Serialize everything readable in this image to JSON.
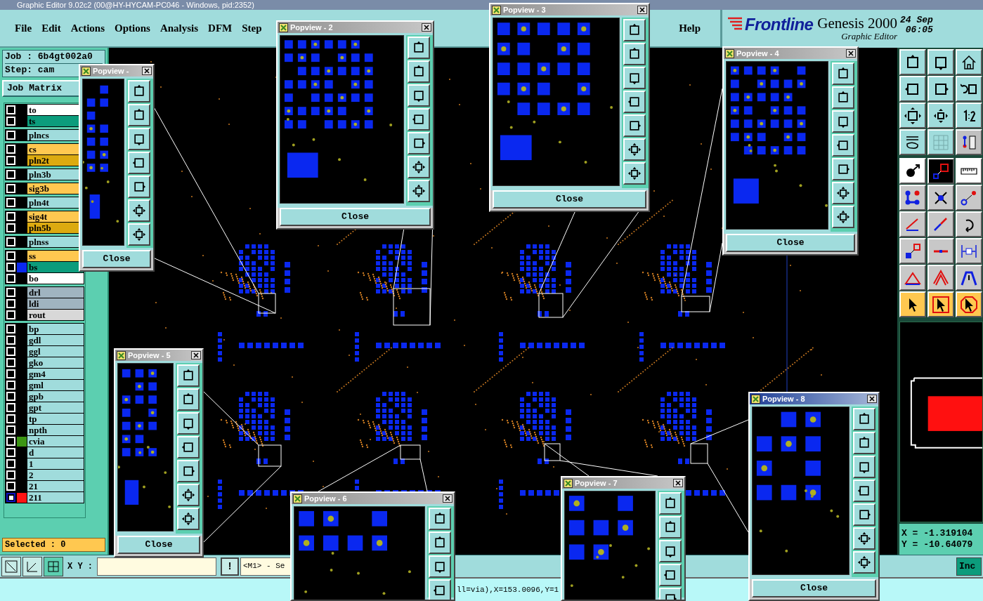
{
  "window": {
    "title": "Graphic Editor 9.02c2 (00@HY-HYCAM-PC046 - Windows, pid:2352)"
  },
  "menu": [
    {
      "label": "File"
    },
    {
      "label": "Edit"
    },
    {
      "label": "Actions"
    },
    {
      "label": "Options"
    },
    {
      "label": "Analysis"
    },
    {
      "label": "DFM"
    },
    {
      "label": "Step"
    }
  ],
  "help_menu": {
    "label": "Help"
  },
  "logo": {
    "brand": "Frontline",
    "product": "Genesis 2000",
    "subtitle": "Graphic Editor",
    "date": "24 Sep",
    "time": "06:05"
  },
  "job": {
    "job": "Job : 6b4gt002a0",
    "step": "Step: cam",
    "matrix_button": "Job Matrix"
  },
  "layer_groups": [
    [
      {
        "name": "to",
        "color": "#ffffff",
        "selected": false
      },
      {
        "name": "ts",
        "color": "#0c9c7c",
        "selected": false
      }
    ],
    [
      {
        "name": "plncs",
        "color": "#a0dcdc",
        "selected": false
      }
    ],
    [
      {
        "name": "cs",
        "color": "#ffc850",
        "selected": false
      },
      {
        "name": "pln2t",
        "color": "#dcaa10",
        "selected": false
      }
    ],
    [
      {
        "name": "pln3b",
        "color": "#a0dcdc",
        "selected": false
      }
    ],
    [
      {
        "name": "sig3b",
        "color": "#ffc850",
        "selected": false
      }
    ],
    [
      {
        "name": "pln4t",
        "color": "#a0dcdc",
        "selected": false
      }
    ],
    [
      {
        "name": "sig4t",
        "color": "#ffc850",
        "selected": false
      },
      {
        "name": "pln5b",
        "color": "#dcaa10",
        "selected": false
      }
    ],
    [
      {
        "name": "plnss",
        "color": "#a0dcdc",
        "selected": false
      }
    ],
    [
      {
        "name": "ss",
        "color": "#ffc850",
        "selected": false
      },
      {
        "name": "bs",
        "color": "#0c9c7c",
        "swatch": {
          "color": "#0a28f0"
        },
        "selected": false
      },
      {
        "name": "bo",
        "color": "#ffffff",
        "selected": false
      }
    ],
    [
      {
        "name": "drl",
        "color": "#a0b4c0",
        "selected": false
      },
      {
        "name": "ldi",
        "color": "#a0b4c0",
        "selected": false
      },
      {
        "name": "rout",
        "color": "#d8d8d8",
        "selected": false
      }
    ],
    [
      {
        "name": "bp",
        "color": "#a0dcdc",
        "selected": false
      },
      {
        "name": "gdl",
        "color": "#a0dcdc",
        "selected": false
      },
      {
        "name": "ggl",
        "color": "#a0dcdc",
        "selected": false
      },
      {
        "name": "gko",
        "color": "#a0dcdc",
        "selected": false
      },
      {
        "name": "gm4",
        "color": "#a0dcdc",
        "selected": false
      },
      {
        "name": "gml",
        "color": "#a0dcdc",
        "selected": false
      },
      {
        "name": "gpb",
        "color": "#a0dcdc",
        "selected": false
      },
      {
        "name": "gpt",
        "color": "#a0dcdc",
        "selected": false
      },
      {
        "name": "tp",
        "color": "#a0dcdc",
        "selected": false
      },
      {
        "name": "npth",
        "color": "#a0dcdc",
        "selected": false
      },
      {
        "name": "cvia",
        "color": "#a0dcdc",
        "swatch": {
          "color": "#3c9614"
        },
        "selected": false
      },
      {
        "name": "d",
        "color": "#a0dcdc",
        "selected": false
      },
      {
        "name": "1",
        "color": "#a0dcdc",
        "selected": false
      },
      {
        "name": "2",
        "color": "#a0dcdc",
        "selected": false
      },
      {
        "name": "21",
        "color": "#a0dcdc",
        "selected": false
      },
      {
        "name": "211",
        "color": "#a0dcdc",
        "swatch": {
          "color": "#ff1414"
        },
        "selected": true
      }
    ]
  ],
  "selected_count": "Selected : 0",
  "popviews": [
    {
      "title": "Popview -",
      "active": false,
      "close_label": "Close"
    },
    {
      "title": "Popview - 2",
      "active": false,
      "close_label": "Close"
    },
    {
      "title": "Popview - 3",
      "active": false,
      "close_label": "Close"
    },
    {
      "title": "Popview - 4",
      "active": false,
      "close_label": "Close"
    },
    {
      "title": "Popview - 5",
      "active": false,
      "close_label": "Close"
    },
    {
      "title": "Popview - 6",
      "active": false
    },
    {
      "title": "Popview - 7",
      "active": false
    },
    {
      "title": "Popview - 8",
      "active": true,
      "close_label": "Close"
    }
  ],
  "coords": {
    "x": "X = -1.319104",
    "y": "Y = -10.64079"
  },
  "command_bar": {
    "xy_label": "X Y :",
    "alert_button": "!",
    "message": "<M1> - Se",
    "inc_button": "Inc"
  },
  "status": "ll=via),X=153.0096,Y=1"
}
